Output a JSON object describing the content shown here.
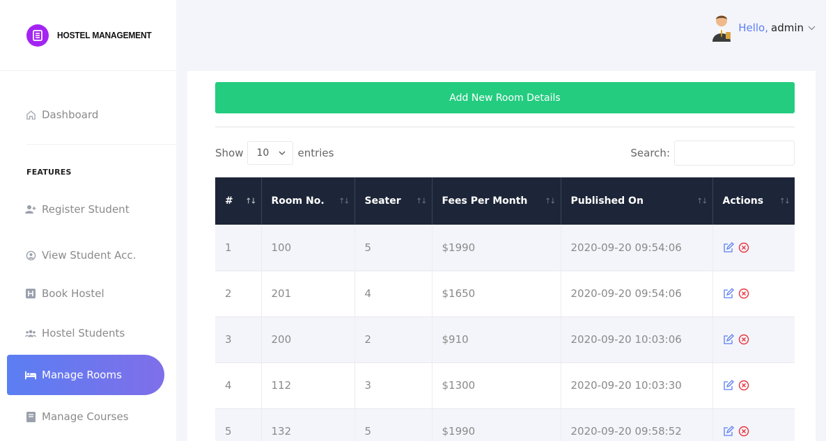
{
  "brand": {
    "name": "HOSTEL MANAGEMENT",
    "logo_color": "#a324f2"
  },
  "header": {
    "greeting": "Hello,",
    "username": "admin"
  },
  "sidebar": {
    "dashboard": "Dashboard",
    "section_label": "FEATURES",
    "items": [
      {
        "label": "Register Student",
        "icon": "user-plus-icon"
      },
      {
        "label": "View Student Acc.",
        "icon": "user-circle-icon"
      },
      {
        "label": "Book Hostel",
        "icon": "hotel-icon"
      },
      {
        "label": "Hostel Students",
        "icon": "users-icon"
      },
      {
        "label": "Manage Rooms",
        "icon": "bed-icon",
        "active": true
      },
      {
        "label": "Manage Courses",
        "icon": "book-icon"
      }
    ]
  },
  "main": {
    "add_button": "Add New Room Details",
    "length": {
      "prefix": "Show",
      "value": "10",
      "suffix": "entries"
    },
    "search_label": "Search:",
    "table": {
      "columns": [
        "#",
        "Room No.",
        "Seater",
        "Fees Per Month",
        "Published On",
        "Actions"
      ],
      "rows": [
        [
          "1",
          "100",
          "5",
          "$1990",
          "2020-09-20 09:54:06"
        ],
        [
          "2",
          "201",
          "4",
          "$1650",
          "2020-09-20 09:54:06"
        ],
        [
          "3",
          "200",
          "2",
          "$910",
          "2020-09-20 10:03:06"
        ],
        [
          "4",
          "112",
          "3",
          "$1300",
          "2020-09-20 10:03:30"
        ],
        [
          "5",
          "132",
          "5",
          "$1990",
          "2020-09-20 09:58:52"
        ]
      ]
    }
  },
  "colors": {
    "accent": "#5b7ef2",
    "success": "#23cc7f",
    "danger": "#e8323e",
    "table_header": "#1d2638"
  }
}
